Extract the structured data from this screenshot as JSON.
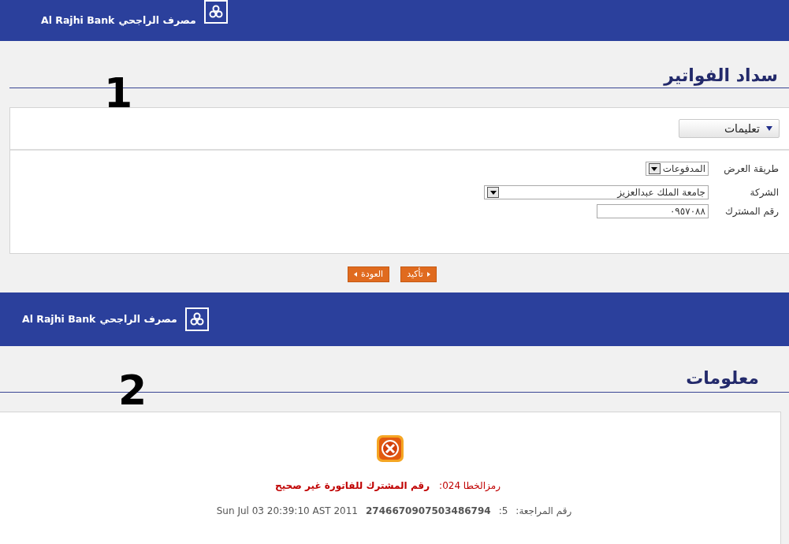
{
  "screen_1": {
    "banner": {
      "brand_en": "Al Rajhi Bank",
      "brand_ar": "مصرف الراجحي"
    },
    "annotation": "1",
    "title": "سداد الفواتير",
    "instructions": {
      "label": "تعليمات",
      "expanded": false
    },
    "form": [
      {
        "kind": "select",
        "label": "طريقة العرض",
        "value": "المدفوعات"
      },
      {
        "kind": "select",
        "label": "الشركة",
        "value": "جامعة الملك عبدالعزيز"
      },
      {
        "kind": "input",
        "label": "رقم المشترك",
        "value": "٠٩٥٧٠٨٨"
      }
    ],
    "buttons": [
      {
        "label": "تأكيد",
        "kind": "next"
      },
      {
        "label": "العودة",
        "kind": "back"
      }
    ]
  },
  "screen_2": {
    "banner": {
      "brand_en": "Al Rajhi Bank",
      "brand_ar": "مصرف الراجحي"
    },
    "annotation": "2",
    "title": "معلومات",
    "error": {
      "code_label": "رمزالخطا 024:",
      "message": "رقم المشترك للفاتورة غير صحيح"
    },
    "reference": {
      "label": "رقم المراجعة:",
      "index": "5:",
      "number": "2746670907503486794",
      "timestamp": "Sun Jul 03 20:39:10 AST 2011"
    }
  }
}
